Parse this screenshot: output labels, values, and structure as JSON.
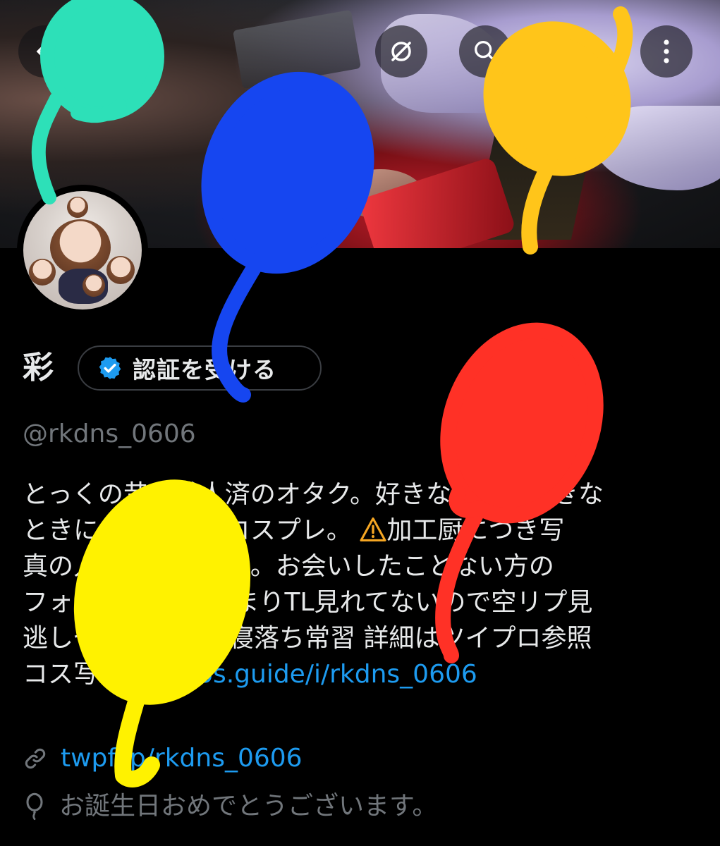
{
  "profile": {
    "name": "彩",
    "verify_label": "認証を受ける",
    "handle": "@rkdns_0606",
    "bio_lines": [
      "とっくの昔に成人済のオタク。好きなものを好きな",
      "ときに。ゲームとコスプレ。 ",
      "真の人気ありません。お会いしたことない方の",
      "フォロー歓迎。 あまりTL見れてないので空リプ見",
      "逃しやすいです ",
      "コス写まとめ:"
    ],
    "bio_line2_after_warn": "加工厨につき写",
    "bio_line5_after_emoji": "寝落ち常習 詳細はツイプロ参照",
    "bio_link": "cos.guide/i/rkdns_0606",
    "website": "twpf.jp/rkdns_0606",
    "birthday": "お誕生日おめでとうございます。"
  },
  "icons": {
    "back": "back-arrow-icon",
    "grok": "grok-icon",
    "search": "search-icon",
    "more": "more-vertical-icon",
    "verified": "verified-badge-icon",
    "link": "link-icon",
    "birthday": "balloon-icon",
    "warning": "warning-icon"
  },
  "colors": {
    "background": "#000000",
    "text": "#e7e9ea",
    "secondary": "#71767b",
    "link": "#1d9bf0",
    "verified": "#1d9bf0",
    "warning": "#f5a623"
  }
}
